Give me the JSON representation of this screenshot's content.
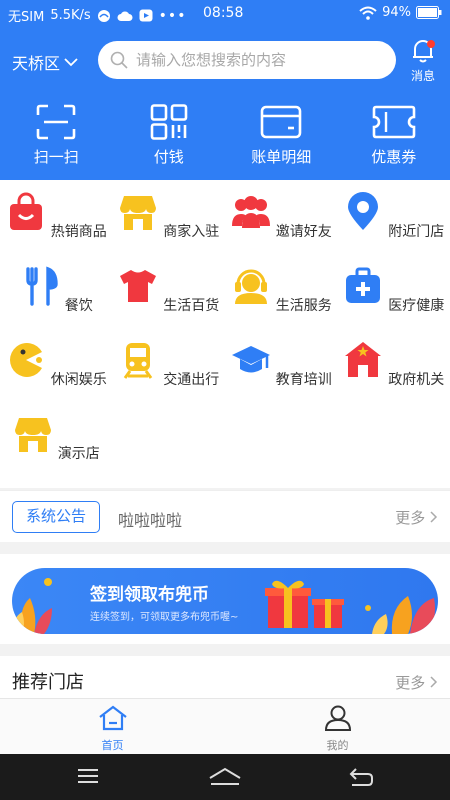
{
  "status_bar": {
    "carrier": "无SIM",
    "speed": "5.5K/s",
    "time": "08:58",
    "battery": "94%"
  },
  "header": {
    "location": "天桥区",
    "search_placeholder": "请输入您想搜索的内容",
    "message_label": "消息"
  },
  "quick_actions": [
    {
      "label": "扫一扫",
      "icon": "scan-icon"
    },
    {
      "label": "付钱",
      "icon": "qr-pay-icon"
    },
    {
      "label": "账单明细",
      "icon": "card-icon"
    },
    {
      "label": "优惠券",
      "icon": "coupon-icon"
    }
  ],
  "categories": [
    {
      "label": "热销商品",
      "icon": "shopping-bag-icon"
    },
    {
      "label": "商家入驻",
      "icon": "store-icon"
    },
    {
      "label": "邀请好友",
      "icon": "friends-icon"
    },
    {
      "label": "附近门店",
      "icon": "location-pin-icon"
    },
    {
      "label": "餐饮",
      "icon": "cutlery-icon"
    },
    {
      "label": "生活百货",
      "icon": "tshirt-icon"
    },
    {
      "label": "生活服务",
      "icon": "headset-icon"
    },
    {
      "label": "医疗健康",
      "icon": "medical-kit-icon"
    },
    {
      "label": "休闲娱乐",
      "icon": "pacman-icon"
    },
    {
      "label": "交通出行",
      "icon": "train-icon"
    },
    {
      "label": "教育培训",
      "icon": "graduation-cap-icon"
    },
    {
      "label": "政府机关",
      "icon": "government-icon"
    },
    {
      "label": "演示店",
      "icon": "shop-icon"
    }
  ],
  "notice": {
    "tag": "系统公告",
    "text": "啦啦啦啦",
    "more": "更多"
  },
  "banner": {
    "title": "签到领取布兜币",
    "subtitle": "连续签到，可领取更多布兜币喔~"
  },
  "recommend": {
    "title": "推荐门店",
    "more": "更多"
  },
  "tabbar": [
    {
      "label": "首页",
      "active": true
    },
    {
      "label": "我的",
      "active": false
    }
  ],
  "colors": {
    "primary": "#2f7ef5",
    "red": "#f0383f",
    "yellow": "#f7c21f",
    "blue_icon": "#2f7ef5"
  }
}
